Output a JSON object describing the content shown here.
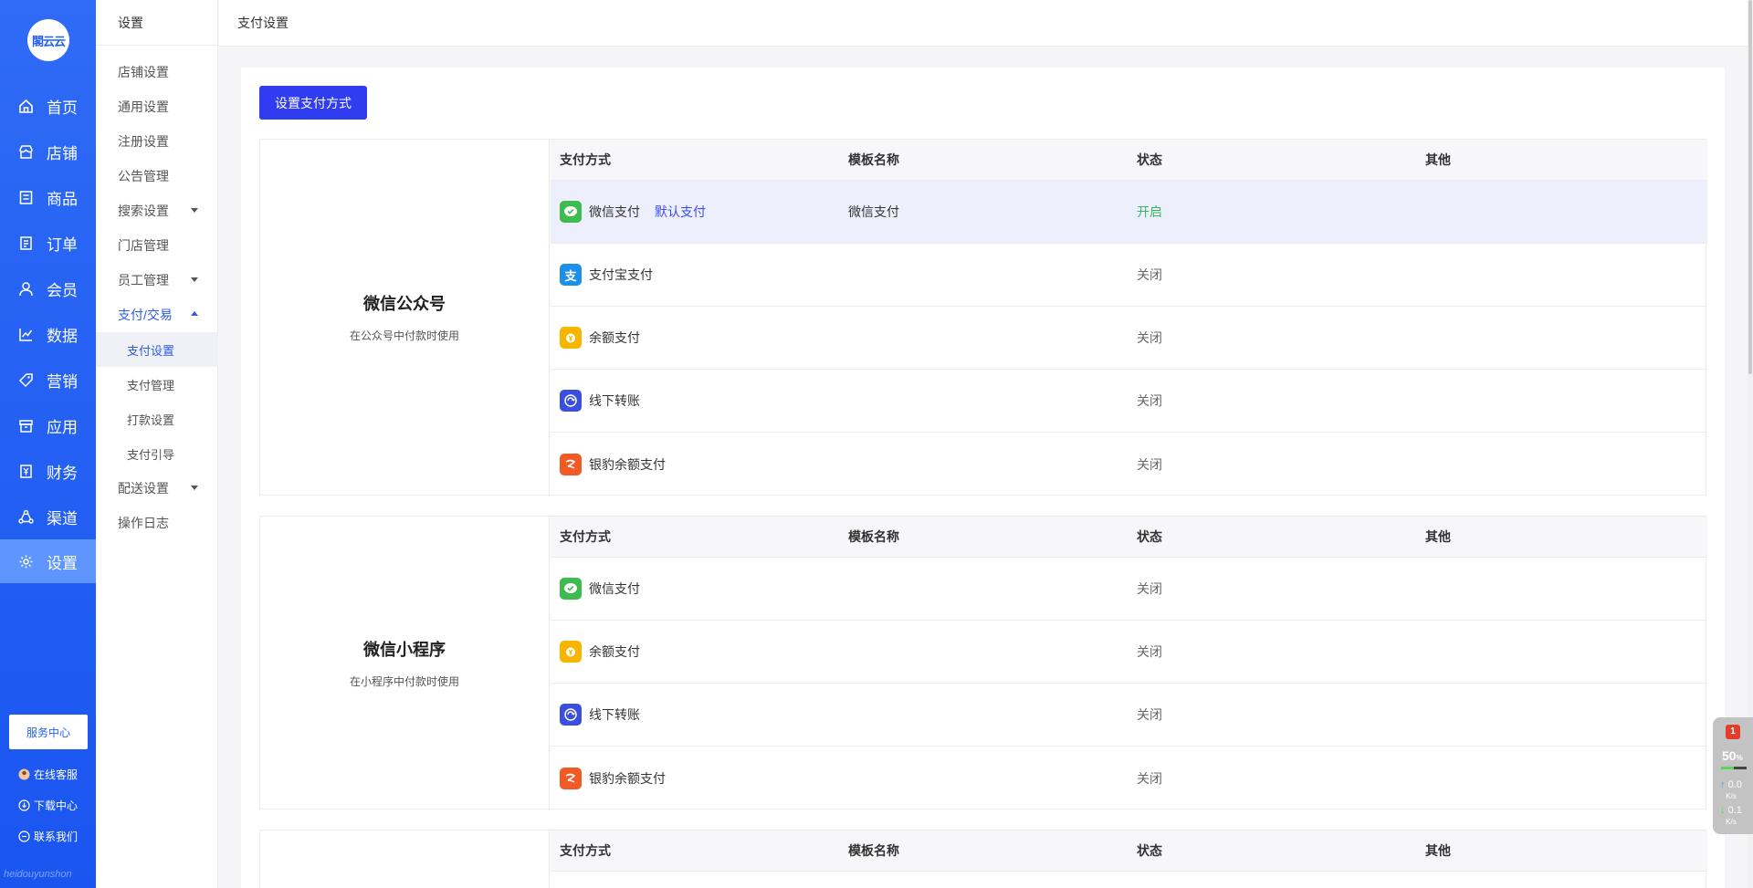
{
  "logo_text": "閣云云",
  "nav": {
    "items": [
      {
        "label": "首页",
        "icon": "home-icon"
      },
      {
        "label": "店铺",
        "icon": "store-icon"
      },
      {
        "label": "商品",
        "icon": "goods-icon"
      },
      {
        "label": "订单",
        "icon": "order-icon"
      },
      {
        "label": "会员",
        "icon": "member-icon"
      },
      {
        "label": "数据",
        "icon": "data-icon"
      },
      {
        "label": "营销",
        "icon": "tag-icon"
      },
      {
        "label": "应用",
        "icon": "app-icon"
      },
      {
        "label": "财务",
        "icon": "finance-icon"
      },
      {
        "label": "渠道",
        "icon": "channel-icon"
      },
      {
        "label": "设置",
        "icon": "gear-icon"
      }
    ],
    "service_center": "服务中心",
    "footer_links": [
      {
        "label": "在线客服",
        "icon": "avatar-icon"
      },
      {
        "label": "下载中心",
        "icon": "download-icon"
      },
      {
        "label": "联系我们",
        "icon": "contact-icon"
      }
    ],
    "watermark": "heidouyunshon"
  },
  "sub": {
    "title": "设置",
    "items": [
      "店铺设置",
      "通用设置",
      "注册设置",
      "公告管理",
      "搜索设置",
      "门店管理",
      "员工管理",
      "支付/交易"
    ],
    "children": [
      "支付设置",
      "支付管理",
      "打款设置",
      "支付引导"
    ],
    "items_after": [
      "配送设置",
      "操作日志"
    ]
  },
  "topbar": {
    "breadcrumb": "支付设置"
  },
  "content": {
    "set_button": "设置支付方式",
    "headers": {
      "method": "支付方式",
      "template": "模板名称",
      "status": "状态",
      "other": "其他"
    },
    "groups": [
      {
        "name": "微信公众号",
        "desc": "在公众号中付款时使用",
        "rows": [
          {
            "method": "微信支付",
            "tag": "默认支付",
            "template": "微信支付",
            "status": "开启",
            "icon": "wechat-pay-icon"
          },
          {
            "method": "支付宝支付",
            "tag": "",
            "template": "",
            "status": "关闭",
            "icon": "alipay-icon"
          },
          {
            "method": "余额支付",
            "tag": "",
            "template": "",
            "status": "关闭",
            "icon": "balance-icon"
          },
          {
            "method": "线下转账",
            "tag": "",
            "template": "",
            "status": "关闭",
            "icon": "transfer-icon"
          },
          {
            "method": "银豹余额支付",
            "tag": "",
            "template": "",
            "status": "关闭",
            "icon": "yinbao-icon"
          }
        ]
      },
      {
        "name": "微信小程序",
        "desc": "在小程序中付款时使用",
        "rows": [
          {
            "method": "微信支付",
            "tag": "",
            "template": "",
            "status": "关闭",
            "icon": "wechat-pay-icon"
          },
          {
            "method": "余额支付",
            "tag": "",
            "template": "",
            "status": "关闭",
            "icon": "balance-icon"
          },
          {
            "method": "线下转账",
            "tag": "",
            "template": "",
            "status": "关闭",
            "icon": "transfer-icon"
          },
          {
            "method": "银豹余额支付",
            "tag": "",
            "template": "",
            "status": "关闭",
            "icon": "yinbao-icon"
          }
        ]
      }
    ]
  },
  "widget": {
    "alert": "1",
    "percent": "50",
    "percent_unit": "%",
    "up_speed": "0.0",
    "down_speed": "0.1",
    "unit": "K/s"
  },
  "colors": {
    "accent": "#2f3cf0",
    "nav_bg": "#2461f3",
    "status_on": "#35b85c"
  }
}
